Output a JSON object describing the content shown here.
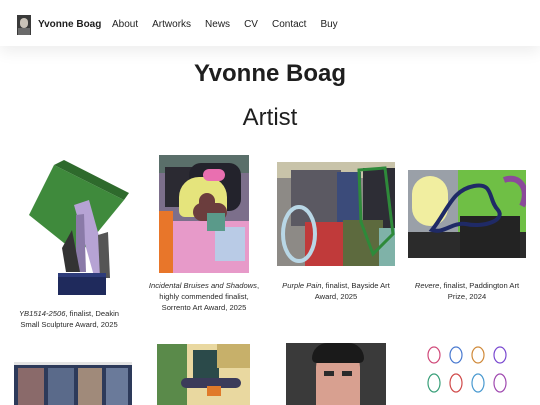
{
  "header": {
    "site_name": "Yvonne Boag",
    "nav": [
      "About",
      "Artworks",
      "News",
      "CV",
      "Contact",
      "Buy"
    ]
  },
  "hero": {
    "title": "Yvonne Boag",
    "tagline": "Artist"
  },
  "works": [
    {
      "title": "YB1514-2506",
      "caption": ", finalist, Deakin Small Sculpture Award, 2025"
    },
    {
      "title": "Incidental Bruises and Shadows",
      "caption": ", highly commended finalist, Sorrento Art Award, 2025"
    },
    {
      "title": "Purple Pain",
      "caption": ", finalist, Bayside Art Award, 2025"
    },
    {
      "title": "Revere",
      "caption": ", finalist, Paddington Art Prize, 2024"
    }
  ],
  "colors": {
    "text": "#1e1e1e",
    "background": "#ffffff"
  }
}
